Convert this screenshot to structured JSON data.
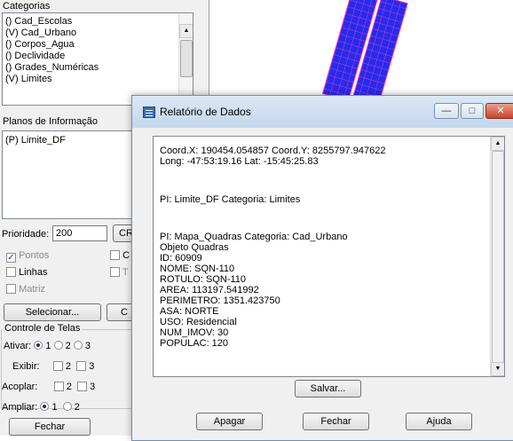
{
  "panel": {
    "categories_label": "Categorias",
    "categories": [
      "() Cad_Escolas",
      "(V) Cad_Urbano",
      "() Corpos_Agua",
      "() Declividade",
      "() Grades_Numéricas",
      "(V) Limites"
    ],
    "planes_label": "Planos de Informação",
    "planes": [
      "(P) Limite_DF"
    ],
    "priority_label": "Prioridade:",
    "priority_value": "200",
    "cr_button": "CR",
    "pontos_label": "Pontos",
    "linhas_label": "Linhas",
    "matriz_label": "Matriz",
    "c_label": "C",
    "t_label": "T",
    "select_button": "Selecionar...",
    "select_button2": "C",
    "screens_group": "Controle de Telas",
    "activate_label": "Ativar:",
    "display_label": "Exibir:",
    "couple_label": "Acoplar:",
    "enlarge_label": "Ampliar:",
    "opt_1": "1",
    "opt_2": "2",
    "opt_3": "3",
    "close_button": "Fechar"
  },
  "dialog": {
    "title": "Relatório de Dados",
    "minimize": "—",
    "maximize": "□",
    "close": "✕",
    "report_lines": [
      "Coord.X: 190454.054857   Coord.Y: 8255797.947622",
      "Long: -47:53:19.16 Lat: -15:45:25.83",
      "PI: Limite_DF Categoria: Limites",
      "PI: Mapa_Quadras Categoria: Cad_Urbano",
      "Objeto Quadras",
      "ID: 60909",
      "NOME: SQN-110",
      "ROTULO: SQN-110",
      "AREA: 113197.541992",
      "PERIMETRO: 1351.423750",
      "ASA: NORTE",
      "USO: Residencial",
      "NUM_IMOV: 30",
      "POPULAC: 120"
    ],
    "save_button": "Salvar...",
    "clear_button": "Apagar",
    "close_button": "Fechar",
    "help_button": "Ajuda"
  },
  "colors": {
    "map_blocks": "#1f2ef0",
    "map_grid": "#ff2bb5"
  }
}
